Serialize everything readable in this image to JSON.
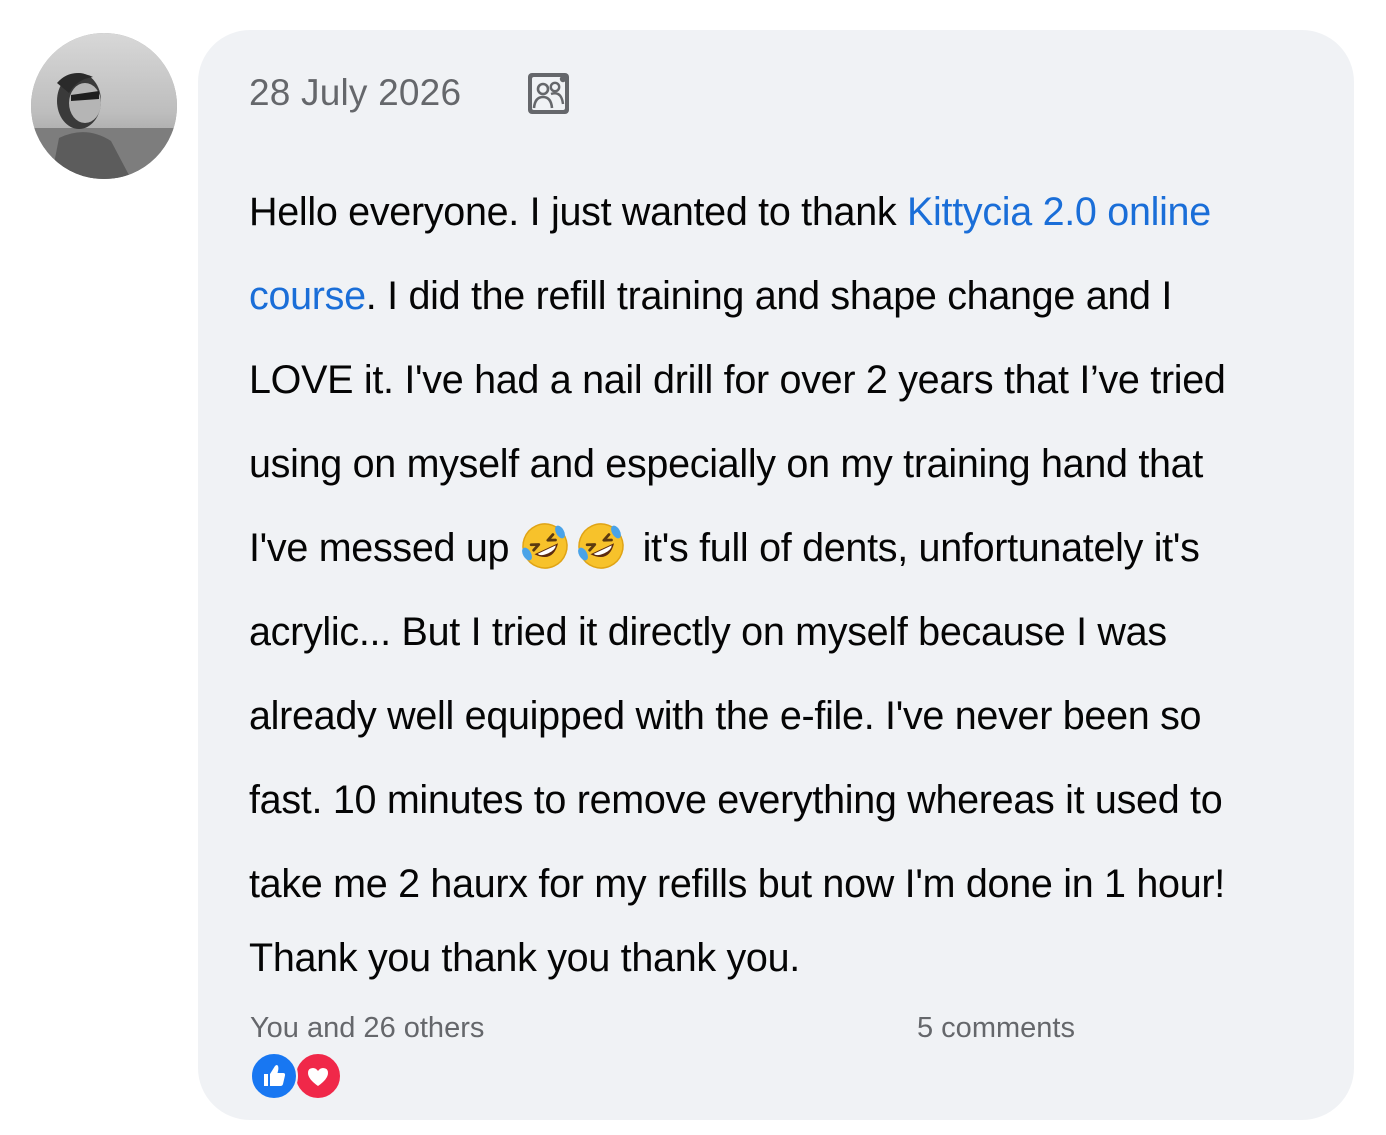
{
  "post": {
    "avatar_icon": "user-avatar",
    "date": "28 July 2026",
    "audience_icon": "group-audience-icon",
    "body": {
      "line1_text": "Hello everyone. I just wanted to thank ",
      "link_part1": "Kittycia 2.0 online",
      "link_part2": "course",
      "line2_text": ". I did the refill training and shape change and I",
      "line3": "LOVE it. I've had a nail drill for over 2 years that I’ve tried",
      "line4": "using on myself and especially on my training hand that",
      "line5_before": "I've messed up ",
      "line5_emoji": "rolling-on-floor-laughing",
      "line5_after": " it's full of dents, unfortunately it's",
      "line6": "acrylic... But I tried it directly on myself because I was",
      "line7": "already well equipped with the e-file. I've never been so",
      "line8": "fast. 10 minutes to remove everything whereas it used to",
      "line9": "take me 2 haurx for my refills but now I'm done in 1 hour!",
      "line10": "Thank you thank you thank you."
    },
    "reactions_text": "You and 26 others",
    "comments": "5 comments",
    "reaction_icons": [
      "like-icon",
      "love-icon"
    ],
    "colors": {
      "card_bg": "#f0f2f5",
      "link": "#1a6ed8",
      "meta_text": "#65676b",
      "like": "#1877f2",
      "love": "#f02849"
    }
  }
}
